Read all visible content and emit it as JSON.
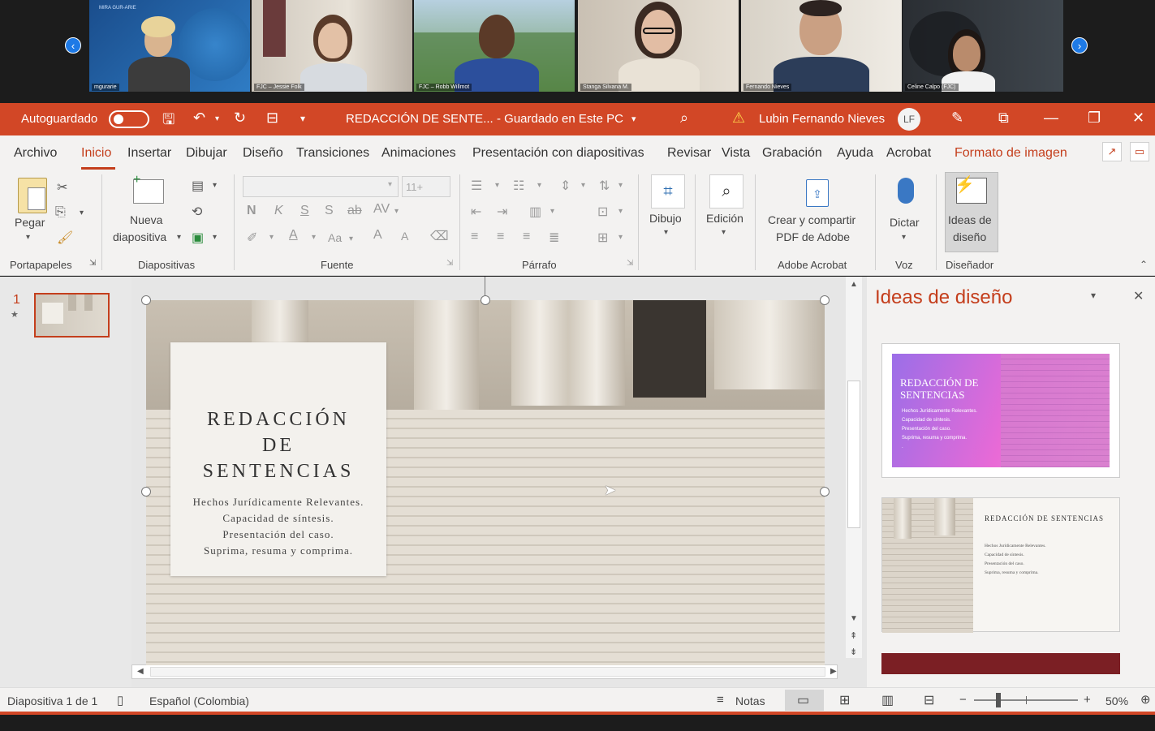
{
  "participants": [
    {
      "name": "mgurarie",
      "banner": "MIRA GUR-ARIE"
    },
    {
      "name": "FJC – Jessie Folk"
    },
    {
      "name": "FJC – Robb Willmot"
    },
    {
      "name": "Stanga Silvana M."
    },
    {
      "name": "Fernando Nieves"
    },
    {
      "name": "Celine Calpo (FJC)"
    }
  ],
  "titlebar": {
    "autosave_label": "Autoguardado",
    "doc_title": "REDACCIÓN DE SENTE...",
    "save_status": "- Guardado en Este PC",
    "user_name": "Lubin Fernando Nieves",
    "user_initials": "LF"
  },
  "tabs": [
    "Archivo",
    "Inicio",
    "Insertar",
    "Dibujar",
    "Diseño",
    "Transiciones",
    "Animaciones",
    "Presentación con diapositivas",
    "Revisar",
    "Vista",
    "Grabación",
    "Ayuda",
    "Acrobat",
    "Formato de imagen"
  ],
  "ribbon": {
    "groups": {
      "clipboard": "Portapapeles",
      "slides": "Diapositivas",
      "font": "Fuente",
      "paragraph": "Párrafo",
      "acrobat": "Adobe Acrobat",
      "voice": "Voz",
      "designer": "Diseñador"
    },
    "paste": "Pegar",
    "new_slide_1": "Nueva",
    "new_slide_2": "diapositiva",
    "font_size_placeholder": "11+",
    "drawing": "Dibujo",
    "editing": "Edición",
    "acrobat_1": "Crear y compartir",
    "acrobat_2": "PDF de Adobe",
    "dictate": "Dictar",
    "design_ideas_1": "Ideas de",
    "design_ideas_2": "diseño",
    "bold": "N",
    "italic": "K",
    "underline": "S",
    "shadow": "S",
    "strike": "ab",
    "spacing": "AV",
    "case": "Aa",
    "grow": "A",
    "shrink": "A"
  },
  "thumb": {
    "number": "1"
  },
  "slide": {
    "title_1": "REDACCIÓN",
    "title_2": "DE",
    "title_3": "SENTENCIAS",
    "bullets": [
      "Hechos Jurídicamente Relevantes.",
      "Capacidad de síntesis.",
      "Presentación del caso.",
      "Suprima, resuma y comprima."
    ]
  },
  "design_pane": {
    "title": "Ideas de diseño",
    "idea1_title": "REDACCIÓN DE SENTENCIAS",
    "idea1_bullets": [
      "Hechos Jurídicamente Relevantes.",
      "Capacidad de síntesis.",
      "Presentación del caso.",
      "Suprima, resuma y comprima.",
      "."
    ],
    "idea2_title": "REDACCIÓN DE SENTENCIAS",
    "idea2_bullets": [
      "Hechos Jurídicamente Relevantes.",
      "Capacidad de síntesis.",
      "Presentación del caso.",
      "Suprima, resuma y comprima."
    ]
  },
  "status": {
    "slide_count": "Diapositiva 1 de 1",
    "language": "Español (Colombia)",
    "notes": "Notas",
    "zoom": "50%"
  },
  "colors": {
    "accent": "#d24726",
    "tab_active": "#c43e1c",
    "idea3": "#7b1f24"
  }
}
